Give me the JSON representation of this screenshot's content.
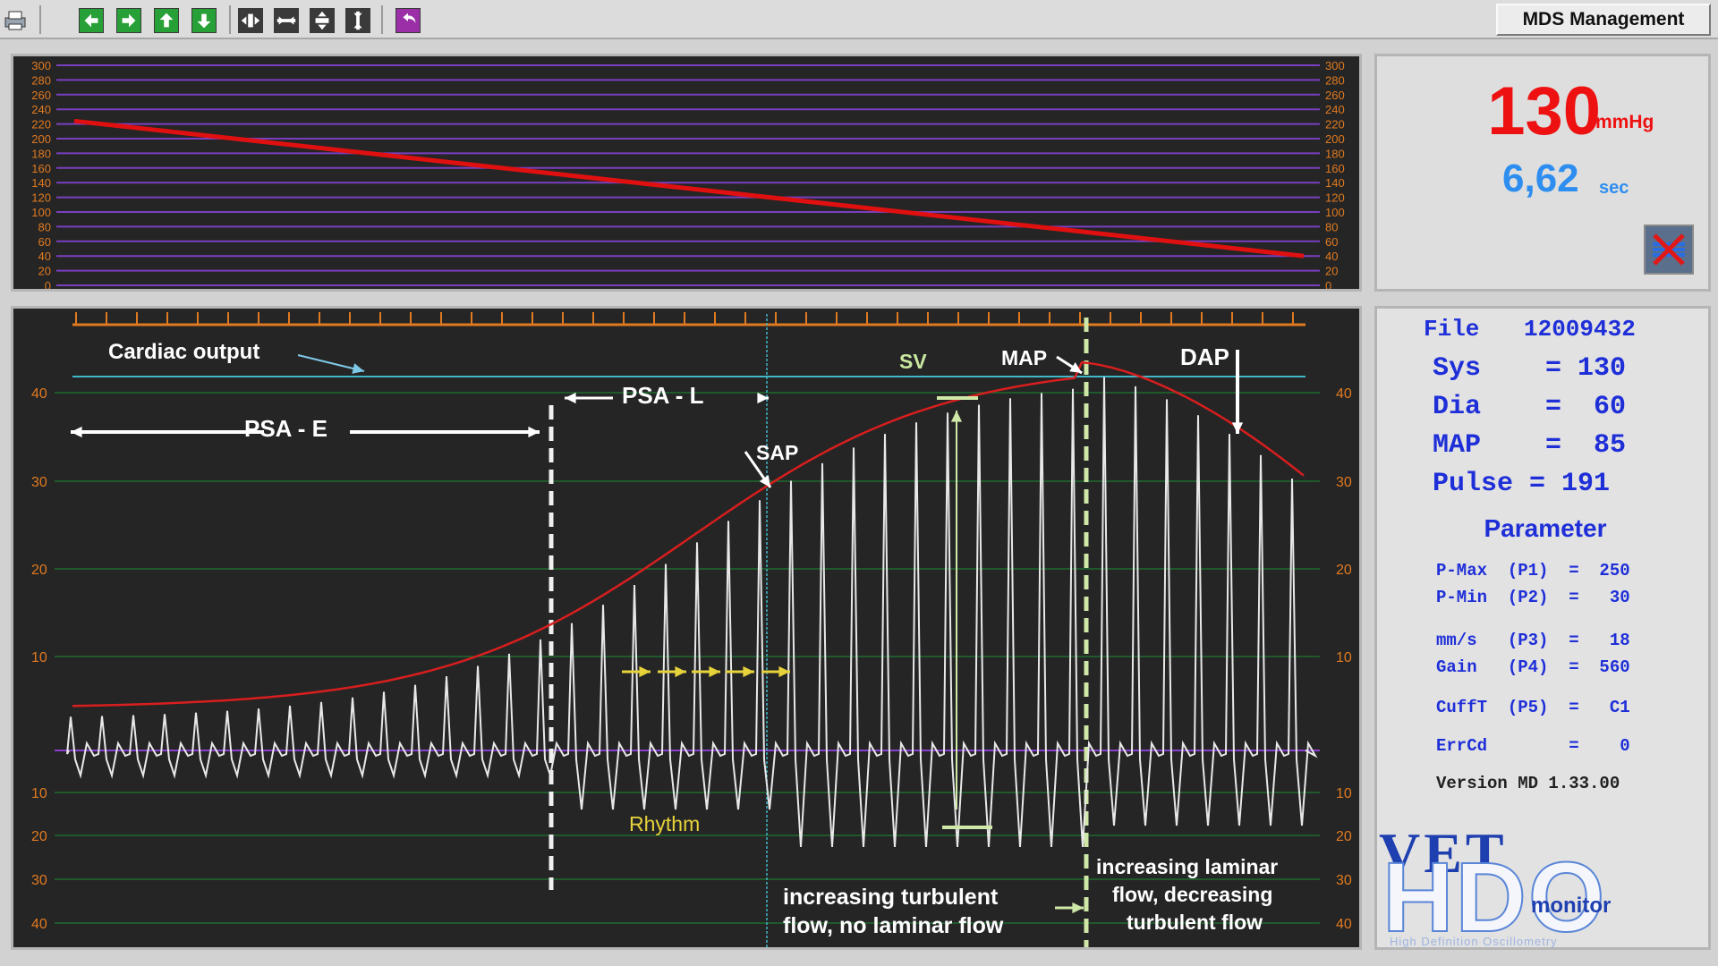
{
  "toolbar": {
    "buttons": [
      "print-button",
      "nav-left-button",
      "nav-right-button",
      "nav-up-button",
      "nav-down-button",
      "zoom-in-h-button",
      "zoom-out-h-button",
      "zoom-in-v-button",
      "zoom-out-v-button",
      "undo-button"
    ],
    "mds_label": "MDS Management"
  },
  "pressure_chart": {
    "ticks": [
      "300",
      "280",
      "260",
      "240",
      "220",
      "200",
      "180",
      "160",
      "140",
      "120",
      "100",
      "80",
      "60",
      "40",
      "20",
      "0"
    ],
    "series_color": "#e01010",
    "grid_color": "#7a3fc0",
    "y_range": [
      0,
      300
    ],
    "line_start": 224,
    "line_end": 40
  },
  "wave_chart": {
    "ticks_top": [
      "40",
      "30",
      "20",
      "10"
    ],
    "ticks_bottom": [
      "10",
      "20",
      "30",
      "40"
    ],
    "labels": {
      "cardiac_output": "Cardiac output",
      "psa_e": "PSA - E",
      "psa_l": "PSA - L",
      "sap": "SAP",
      "sv": "SV",
      "map": "MAP",
      "dap": "DAP",
      "rhythm": "Rhythm",
      "turbulent_1": "increasing turbulent",
      "turbulent_2": "flow, no laminar flow",
      "laminar_1": "increasing laminar",
      "laminar_2": "flow, decreasing",
      "laminar_3": "turbulent flow"
    },
    "envelope_color": "#d81e1e",
    "wave_color": "#e8e8e8",
    "cardiac_line_color": "#3fb8c8",
    "baseline_color": "#8a3fd0",
    "grid_color": "#1e6b2e",
    "ruler_color": "#e07a20"
  },
  "readout": {
    "pressure_value": "130",
    "pressure_unit": "mmHg",
    "time_value": "6,62",
    "time_unit": "sec"
  },
  "results": {
    "file_label": "File",
    "file_value": "12009432",
    "sys": "Sys    = 130",
    "dia": "Dia    =  60",
    "map": "MAP    =  85",
    "pulse": "Pulse = 191"
  },
  "parameters": {
    "heading": "Parameter",
    "pmax": "P-Max  (P1)  =  250",
    "pmin": "P-Min  (P2)  =   30",
    "mms": "mm/s   (P3)  =   18",
    "gain": "Gain   (P4)  =  560",
    "cufft": "CuffT  (P5)  =   C1",
    "errcd": "ErrCd        =    0",
    "version": "Version MD 1.33.00"
  },
  "logo": {
    "top": "VET",
    "main": "HDO",
    "sub": "monitor",
    "tagline": "High Definition Oscillometry"
  }
}
